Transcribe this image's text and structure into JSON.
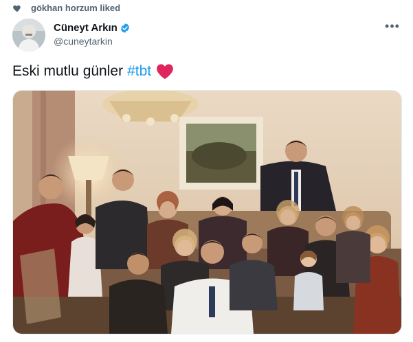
{
  "social_context": {
    "text": "gökhan horzum liked",
    "icon": "heart-icon"
  },
  "author": {
    "name": "Cüneyt Arkın",
    "handle": "@cuneytarkin",
    "verified": true,
    "verified_color": "#1d9bf0"
  },
  "menu": {
    "icon": "more-icon",
    "label": "•••"
  },
  "tweet": {
    "text": "Eski mutlu günler",
    "hashtag": "#tbt",
    "emoji": "red-heart-emoji"
  },
  "colors": {
    "link": "#1d9bf0",
    "secondary_text": "#536471",
    "heart": "#e0245e"
  },
  "media": {
    "type": "photo"
  }
}
